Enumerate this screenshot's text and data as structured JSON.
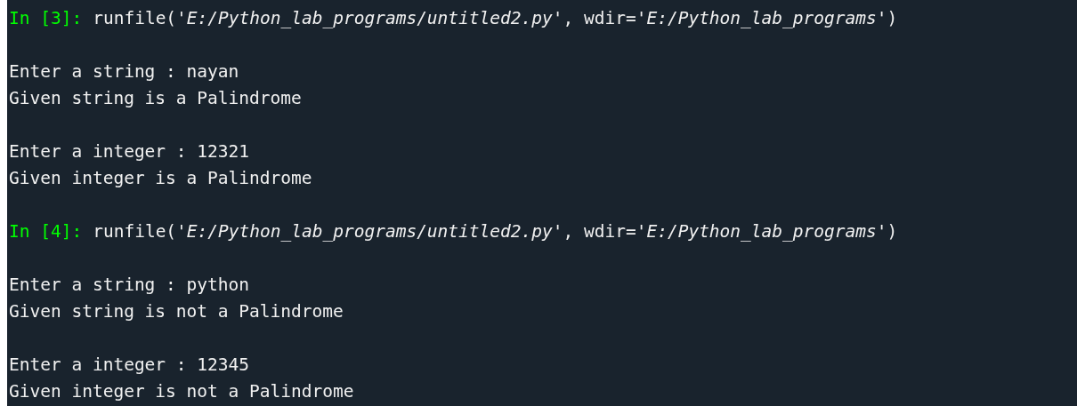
{
  "console": {
    "cells": [
      {
        "prompt": "In [3]:",
        "code": "runfile(*'E:/Python_lab_programs/untitled2.py'*, wdir=*'E:/Python_lab_programs'*)",
        "outputs": [
          [
            "Enter a string : nayan",
            "Given string is a Palindrome"
          ],
          [
            "Enter a integer : 12321",
            "Given integer is a Palindrome"
          ]
        ]
      },
      {
        "prompt": "In [4]:",
        "code": "runfile(*'E:/Python_lab_programs/untitled2.py'*, wdir=*'E:/Python_lab_programs'*)",
        "outputs": [
          [
            "Enter a string : python",
            "Given string is not a Palindrome"
          ],
          [
            "Enter a integer : 12345",
            "Given integer is not a Palindrome"
          ]
        ]
      }
    ]
  }
}
